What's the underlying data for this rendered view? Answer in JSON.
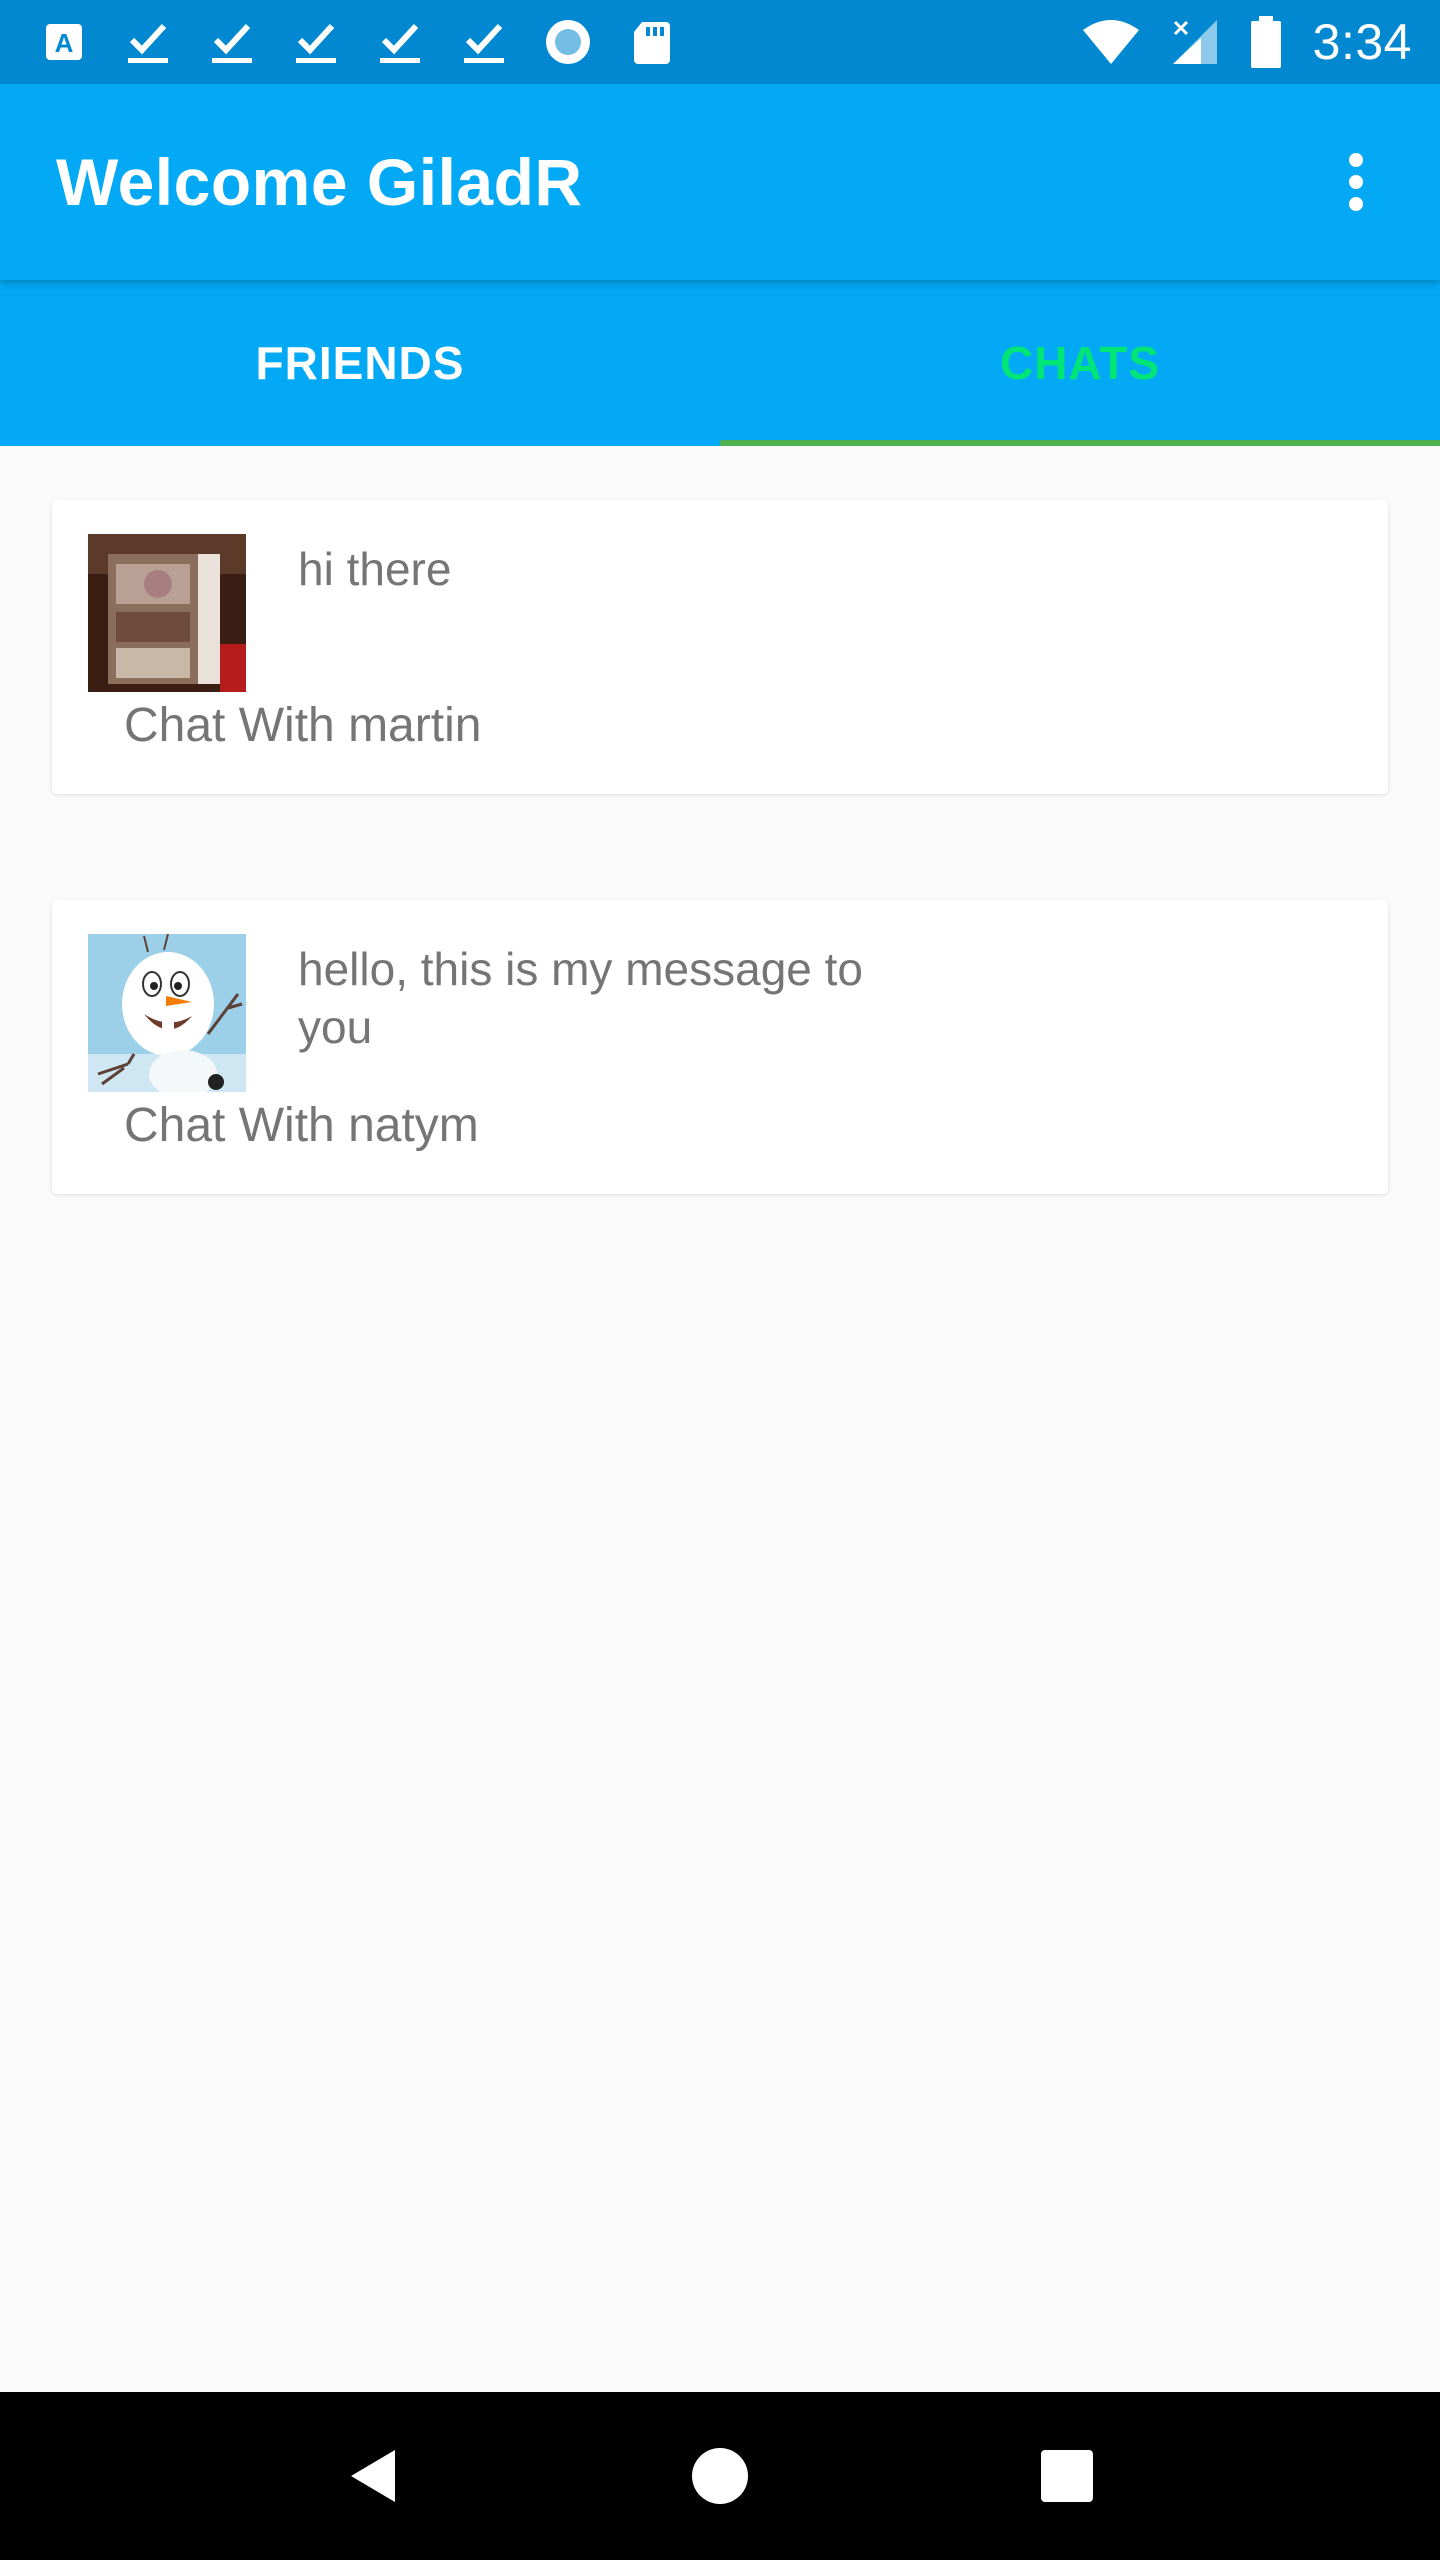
{
  "status_bar": {
    "left_icons": [
      "font-a-icon",
      "check-download-icon",
      "check-download-icon",
      "check-download-icon",
      "check-download-icon",
      "check-download-icon",
      "record-circle-icon",
      "sd-card-icon"
    ],
    "right_icons": [
      "wifi-icon",
      "cellular-no-signal-icon",
      "battery-icon"
    ],
    "time": "3:34"
  },
  "app_bar": {
    "title": "Welcome GiladR",
    "overflow_icon": "more-vert-icon"
  },
  "tabs": [
    {
      "label": "FRIENDS",
      "active": false
    },
    {
      "label": "CHATS",
      "active": true
    }
  ],
  "chats": [
    {
      "avatar": "martin-photo",
      "message": "hi there",
      "title": "Chat With martin"
    },
    {
      "avatar": "snowman-photo",
      "message": "hello, this is my message to you",
      "title": "Chat With natym"
    }
  ],
  "nav_bar": {
    "buttons": [
      "back-icon",
      "home-icon",
      "recents-icon"
    ]
  },
  "colors": {
    "status_bar": "#0288d1",
    "app_bar": "#03a9f4",
    "active_tab_text": "#00e676",
    "tab_indicator": "#4caf50",
    "background": "#fafafa"
  }
}
